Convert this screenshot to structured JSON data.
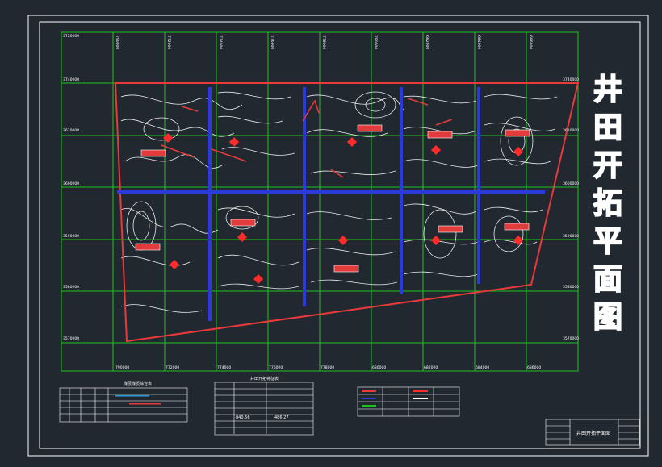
{
  "drawing": {
    "title_chars": [
      "井",
      "田",
      "开",
      "拓",
      "平",
      "面",
      "图"
    ],
    "title_block_text": "井田开拓平面图",
    "table_left_title": "煤层煤质综合表",
    "table_mid_title": "井田开拓特征表",
    "mid_table_values": [
      "840.56",
      "486.27"
    ],
    "left_coord_labels": [
      "3720000",
      "3740000",
      "3610000",
      "3600000",
      "3590000",
      "3580000",
      "3570000"
    ],
    "right_coord_labels": [
      "3740000",
      "3610000",
      "3600000",
      "3590000",
      "3580000",
      "3570000"
    ],
    "top_coord_labels": [
      "790000",
      "772000",
      "774000",
      "776000",
      "778000",
      "780000",
      "682000",
      "684000",
      "686000"
    ],
    "bottom_coord_labels": [
      "790000",
      "772000",
      "774000",
      "776000",
      "778000",
      "680000",
      "682000",
      "684000",
      "686000"
    ]
  },
  "colors": {
    "background": "#212830",
    "border": "#ffffff",
    "grid": "#1cc51c",
    "contour": "#ffffff",
    "boundary": "#e83a3a",
    "roadway": "#2a3bd8",
    "marker": "#ff2a2a"
  }
}
